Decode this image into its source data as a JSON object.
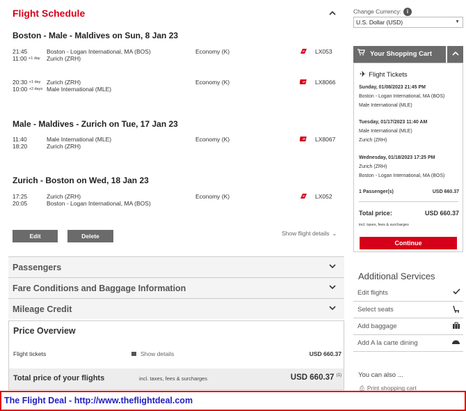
{
  "schedule": {
    "title": "Flight Schedule",
    "segments": [
      {
        "title": "Boston - Male - Maldives on Sun, 8 Jan 23",
        "flights": [
          {
            "dep_time": "21:45",
            "arr_time": "11:00",
            "arr_offset": "+1 day",
            "from": "Boston - Logan International, MA (BOS)",
            "to": "Zurich (ZRH)",
            "class": "Economy (K)",
            "flight_no": "LX053"
          },
          {
            "dep_time": "20:30",
            "dep_offset": "+1 day",
            "arr_time": "10:00",
            "arr_offset": "+2 days",
            "from": "Zurich (ZRH)",
            "to": "Male International (MLE)",
            "class": "Economy (K)",
            "flight_no": "LX8066"
          }
        ]
      },
      {
        "title": "Male - Maldives - Zurich on Tue, 17 Jan 23",
        "flights": [
          {
            "dep_time": "11:40",
            "arr_time": "18:20",
            "from": "Male International (MLE)",
            "to": "Zurich (ZRH)",
            "class": "Economy (K)",
            "flight_no": "LX8067"
          }
        ]
      },
      {
        "title": "Zurich - Boston on Wed, 18 Jan 23",
        "flights": [
          {
            "dep_time": "17:25",
            "arr_time": "20:05",
            "from": "Zurich (ZRH)",
            "to": "Boston - Logan International, MA (BOS)",
            "class": "Economy (K)",
            "flight_no": "LX052"
          }
        ]
      }
    ],
    "edit_label": "Edit",
    "delete_label": "Delete",
    "show_details_label": "Show flight details"
  },
  "accordions": {
    "passengers": "Passengers",
    "fare": "Fare Conditions and Baggage Information",
    "mileage": "Mileage Credit"
  },
  "price_overview": {
    "title": "Price Overview",
    "flight_tickets_label": "Flight tickets",
    "show_details": "Show details",
    "flight_tickets_value": "USD 660.37",
    "total_label": "Total price of your flights",
    "total_note": "incl. taxes, fees & surcharges",
    "total_value": "USD 660.37",
    "total_footnote": "(1)"
  },
  "currency": {
    "label": "Change Currency:",
    "selected": "U.S. Dollar (USD)"
  },
  "cart": {
    "title": "Your Shopping Cart",
    "section": "Flight Tickets",
    "legs": [
      {
        "when": "Sunday, 01/08/2023 21:45 PM",
        "from": "Boston - Logan International, MA (BOS)",
        "to": "Male International (MLE)"
      },
      {
        "when": "Tuesday, 01/17/2023 11:40 AM",
        "from": "Male International (MLE)",
        "to": "Zurich (ZRH)"
      },
      {
        "when": "Wednesday, 01/18/2023 17:25 PM",
        "from": "Zurich (ZRH)",
        "to": "Boston - Logan International, MA (BOS)"
      }
    ],
    "passengers_label": "1 Passenger(s)",
    "passengers_value": "USD 660.37",
    "total_label": "Total price:",
    "total_value": "USD 660.37",
    "total_note": "incl. taxes, fees & surcharges",
    "continue_label": "Continue"
  },
  "additional_services": {
    "title": "Additional Services",
    "items": [
      {
        "label": "Edit flights",
        "icon": "checkmark-icon"
      },
      {
        "label": "Select seats",
        "icon": "seat-icon"
      },
      {
        "label": "Add baggage",
        "icon": "baggage-icon"
      },
      {
        "label": "Add A la carte dining",
        "icon": "dining-icon"
      }
    ]
  },
  "also": {
    "title": "You can also ...",
    "print": "Print shopping cart"
  },
  "footer": {
    "text": "The Flight Deal - http://www.theflightdeal.com"
  },
  "colors": {
    "brand_red": "#d5001a",
    "button_gray": "#6b6b6b",
    "footer_text": "#2020c0"
  }
}
